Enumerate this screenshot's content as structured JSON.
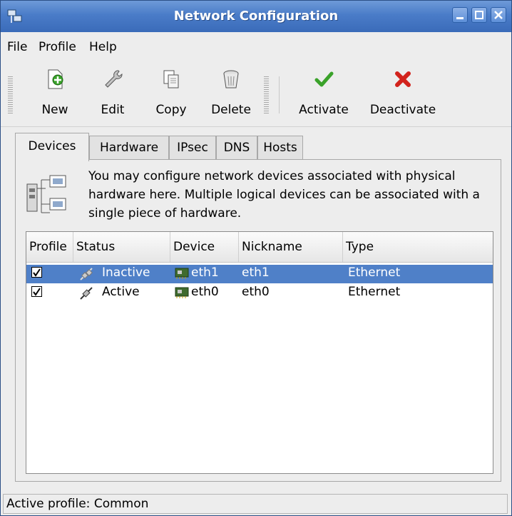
{
  "window": {
    "title": "Network Configuration"
  },
  "menu": {
    "file": "File",
    "profile": "Profile",
    "help": "Help"
  },
  "toolbar": {
    "new": "New",
    "edit": "Edit",
    "copy": "Copy",
    "delete": "Delete",
    "activate": "Activate",
    "deactivate": "Deactivate"
  },
  "tabs": {
    "devices": "Devices",
    "hardware": "Hardware",
    "ipsec": "IPsec",
    "dns": "DNS",
    "hosts": "Hosts"
  },
  "info_text": "You may configure network devices associated with physical hardware here.  Multiple logical devices can be associated with a single piece of hardware.",
  "columns": {
    "profile": "Profile",
    "status": "Status",
    "device": "Device",
    "nickname": "Nickname",
    "type": "Type"
  },
  "rows": [
    {
      "profile_checked": true,
      "status": "Inactive",
      "device": "eth1",
      "nickname": "eth1",
      "type": "Ethernet",
      "selected": true
    },
    {
      "profile_checked": true,
      "status": "Active",
      "device": "eth0",
      "nickname": "eth0",
      "type": "Ethernet",
      "selected": false
    }
  ],
  "statusbar": "Active profile: Common",
  "colors": {
    "titlebar": "#4a7cc8",
    "selection": "#4f80c8",
    "activate_green": "#3aa22a",
    "deactivate_red": "#d2231c"
  }
}
